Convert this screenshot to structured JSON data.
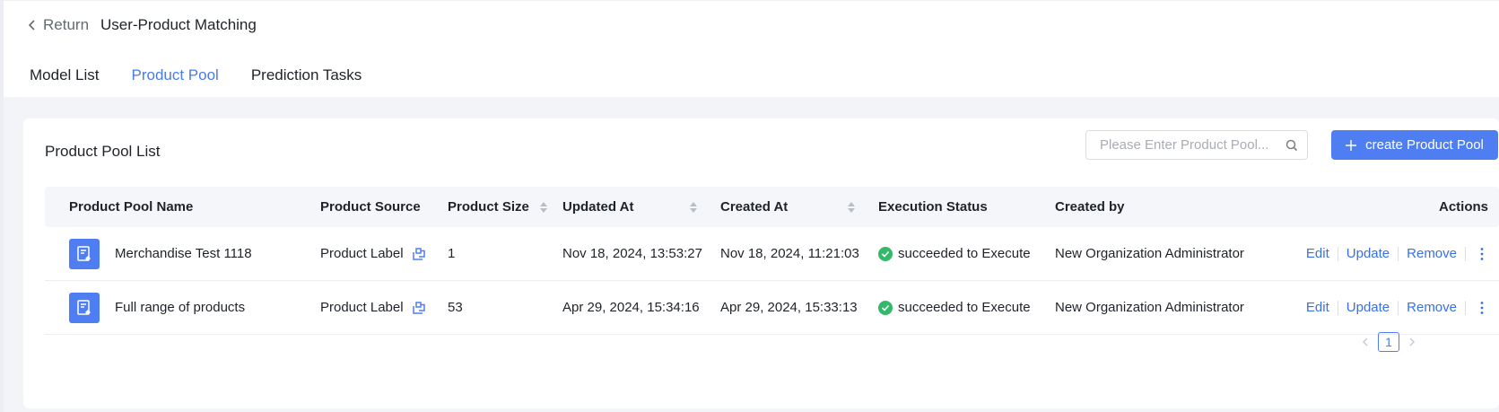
{
  "header": {
    "return_label": "Return",
    "title": "User-Product Matching",
    "tabs": [
      {
        "label": "Model List",
        "active": false
      },
      {
        "label": "Product Pool",
        "active": true
      },
      {
        "label": "Prediction Tasks",
        "active": false
      }
    ]
  },
  "card": {
    "title": "Product Pool List",
    "search": {
      "placeholder": "Please Enter Product Pool...",
      "value": ""
    },
    "create_label": "create Product Pool"
  },
  "table": {
    "columns": [
      "Product Pool Name",
      "Product Source",
      "Product Size",
      "Updated At",
      "Created At",
      "Execution Status",
      "Created by",
      "Actions"
    ],
    "rows": [
      {
        "name": "Merchandise Test 1118",
        "source": "Product Label",
        "size": "1",
        "updated_at": "Nov 18, 2024, 13:53:27",
        "created_at": "Nov 18, 2024, 11:21:03",
        "status": "succeeded to Execute",
        "created_by": "New Organization Administrator",
        "actions": [
          "Edit",
          "Update",
          "Remove"
        ]
      },
      {
        "name": "Full range of products",
        "source": "Product Label",
        "size": "53",
        "updated_at": "Apr 29, 2024, 15:34:16",
        "created_at": "Apr 29, 2024, 15:33:13",
        "status": "succeeded to Execute",
        "created_by": "New Organization Administrator",
        "actions": [
          "Edit",
          "Update",
          "Remove"
        ]
      }
    ]
  },
  "pagination": {
    "current_page": "1"
  },
  "colors": {
    "accent": "#4e7ef1",
    "link": "#3a6fe6",
    "success": "#34b86a"
  },
  "icons": [
    "chevron-left-icon",
    "search-icon",
    "plus-icon",
    "product-pool-icon",
    "link-share-icon",
    "check-circle-icon",
    "more-vertical-icon",
    "chevron-right-icon"
  ]
}
